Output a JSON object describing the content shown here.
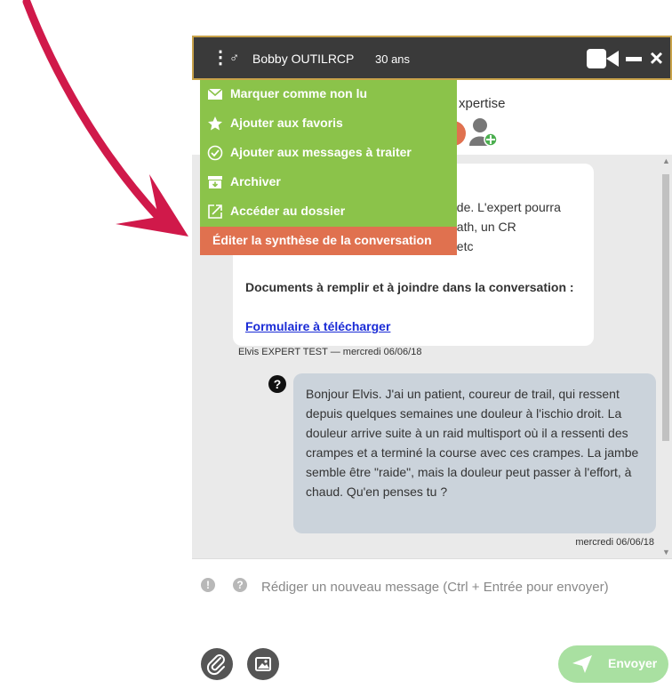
{
  "header": {
    "gender_symbol": "♂",
    "patient_name": "Bobby OUTILRCP",
    "age": "30 ans"
  },
  "subheader": {
    "title_fragment": "xpertise"
  },
  "menu": {
    "items": [
      {
        "label": "Marquer comme non lu",
        "icon": "envelope-icon"
      },
      {
        "label": "Ajouter aux favoris",
        "icon": "star-icon"
      },
      {
        "label": "Ajouter aux messages à traiter",
        "icon": "check-circle-icon"
      },
      {
        "label": "Archiver",
        "icon": "archive-icon"
      },
      {
        "label": "Accéder au dossier",
        "icon": "open-external-icon"
      },
      {
        "label": "Éditer la synthèse de la conversation",
        "highlighted": true
      }
    ]
  },
  "card": {
    "line1": ":",
    "line2": "nde. L'expert pourra",
    "line3": "path, un CR",
    "line4": ", etc",
    "documents_heading": "Documents à remplir et à joindre dans la conversation :",
    "form_link": "Formulaire à télécharger"
  },
  "meta1": "Elvis EXPERT TEST  —  mercredi 06/06/18",
  "question_symbol": "?",
  "message": {
    "text": "Bonjour Elvis. J'ai un patient, coureur de trail, qui ressent depuis quelques semaines une douleur à l'ischio droit. La douleur arrive suite à un raid multisport où il a ressenti des crampes et a terminé la course avec ces crampes. La jambe semble être \"raide\", mais la douleur peut passer à l'effort, à chaud. Qu'en penses tu ?",
    "timestamp": "mercredi 06/06/18"
  },
  "composer": {
    "warning_symbol": "!",
    "help_symbol": "?",
    "placeholder": "Rédiger un nouveau message (Ctrl + Entrée pour envoyer)",
    "send_label": "Envoyer"
  },
  "colors": {
    "header_bg": "#3a3a3a",
    "menu_green": "#8bc34a",
    "menu_highlight": "#e0714f",
    "arrow": "#d0194a",
    "send_green": "#a9e0a1"
  }
}
